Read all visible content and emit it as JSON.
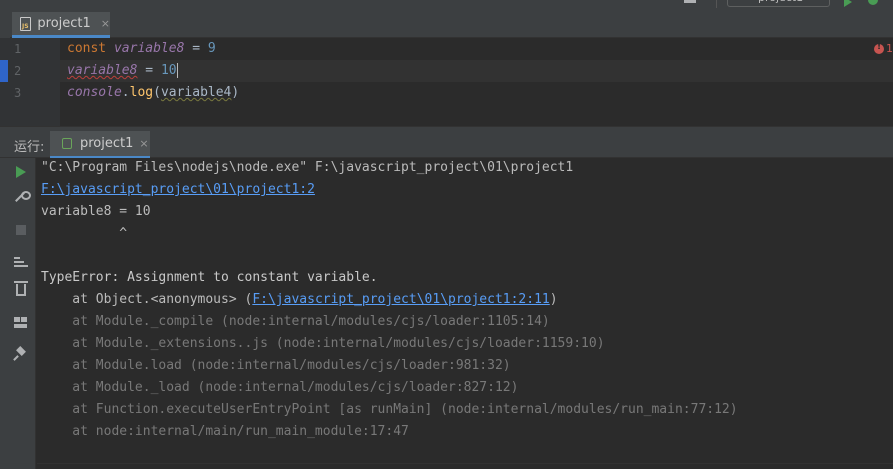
{
  "editor_tab": {
    "label": "project1",
    "close": "×"
  },
  "top_right": {
    "config_label": "project1"
  },
  "editor": {
    "line_numbers": [
      "1",
      "2",
      "3"
    ],
    "line1": {
      "kw": "const",
      "var": "variable8",
      "op": " = ",
      "num": "9"
    },
    "line2": {
      "var": "variable8",
      "op": " = ",
      "num": "10"
    },
    "line3": {
      "obj": "console",
      "dot": ".",
      "fn": "log",
      "open": "(",
      "arg": "variable4",
      "close": ")"
    },
    "error_count": "1"
  },
  "run_panel": {
    "title": "运行:",
    "tab_label": "project1",
    "tab_close": "×",
    "output": {
      "cmd": "\"C:\\Program Files\\nodejs\\node.exe\" F:\\javascript_project\\01\\project1",
      "location_link": "F:\\javascript_project\\01\\project1:2",
      "source_line": "variable8 = 10",
      "caret_line": "          ^",
      "error": "TypeError: Assignment to constant variable.",
      "stack_first_prefix": "    at Object.<anonymous> (",
      "stack_first_link": "F:\\javascript_project\\01\\project1:2:11",
      "stack_first_suffix": ")",
      "stack": [
        "    at Module._compile (node:internal/modules/cjs/loader:1105:14)",
        "    at Module._extensions..js (node:internal/modules/cjs/loader:1159:10)",
        "    at Module.load (node:internal/modules/cjs/loader:981:32)",
        "    at Module._load (node:internal/modules/cjs/loader:827:12)",
        "    at Function.executeUserEntryPoint [as runMain] (node:internal/modules/run_main:77:12)",
        "    at node:internal/main/run_main_module:17:47"
      ]
    }
  },
  "colors": {
    "accent": "#4a88c7",
    "run_green": "#499c54",
    "link": "#589df6",
    "error_red": "#c75450"
  }
}
